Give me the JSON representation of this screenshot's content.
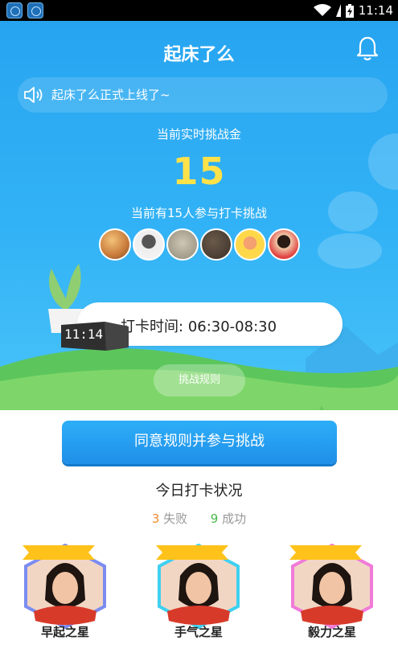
{
  "status_bar": {
    "time": "11:14"
  },
  "header": {
    "title": "起床了么"
  },
  "notice": {
    "text": "起床了么正式上线了~"
  },
  "challenge": {
    "pool_label": "当前实时挑战金",
    "pool_amount": "15",
    "participants_text": "当前有15人参与打卡挑战"
  },
  "checkin": {
    "label": "打卡时间:",
    "time_range": "06:30-08:30",
    "clock_time": "11:14"
  },
  "rules_button": {
    "label": "挑战规则"
  },
  "join_button": {
    "label": "同意规则并参与挑战"
  },
  "today": {
    "heading": "今日打卡状况",
    "fail_count": "3",
    "fail_label": "失败",
    "success_count": "9",
    "success_label": "成功"
  },
  "stars": [
    {
      "label": "早起之星",
      "border_color": "#7b8cf0"
    },
    {
      "label": "手气之星",
      "border_color": "#3fd0f0"
    },
    {
      "label": "毅力之星",
      "border_color": "#f07bd8"
    }
  ],
  "colors": {
    "primary": "#29a6f2",
    "amount": "#ffe24a",
    "fail": "#f08a30",
    "success": "#4cb94c",
    "badge": "#ffc21a"
  }
}
